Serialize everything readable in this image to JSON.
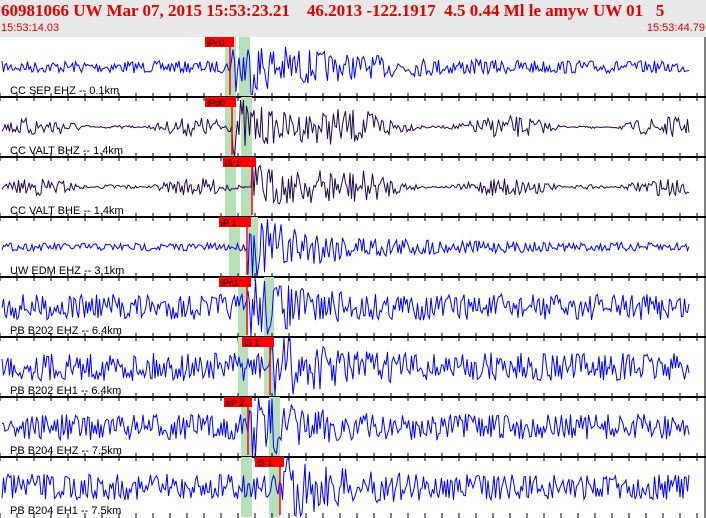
{
  "header": {
    "title": "60981066 UW Mar 07, 2015 15:53:23.21    46.2013 -122.1917  4.5 0.44 Ml le amyw UW 01   5",
    "start_time": "15:53:14.03",
    "end_time": "15:53:44.79"
  },
  "colors": {
    "pick": "#ff0000",
    "band": "#b8e0b8",
    "trace_blue": "#0000ff",
    "trace_dark": "#24084e"
  },
  "channels": [
    {
      "label": "CC SEP EHZ -- 0.1km",
      "pick": "iPc0",
      "color": "trace_blue"
    },
    {
      "label": "CC VALT BHZ -- 1.4km",
      "pick": "iPd0",
      "color": "trace_dark"
    },
    {
      "label": "CC VALT BHE -- 1.4km",
      "pick": "iS 1",
      "color": "trace_dark"
    },
    {
      "label": "UW EDM EHZ -- 3.1km",
      "pick": "iP 1",
      "color": "trace_blue"
    },
    {
      "label": "PB B202 EHZ -- 6.4km",
      "pick": "iPc1",
      "color": "trace_blue"
    },
    {
      "label": "PB B202 EH1 -- 6.4km",
      "pick": "iS 1",
      "color": "trace_blue"
    },
    {
      "label": "PB B204 EHZ -- 7.5km",
      "pick": "eP 2",
      "color": "trace_blue"
    },
    {
      "label": "PB B204 EH1 -- 7.5km",
      "pick": "iS 1",
      "color": "trace_blue"
    }
  ]
}
